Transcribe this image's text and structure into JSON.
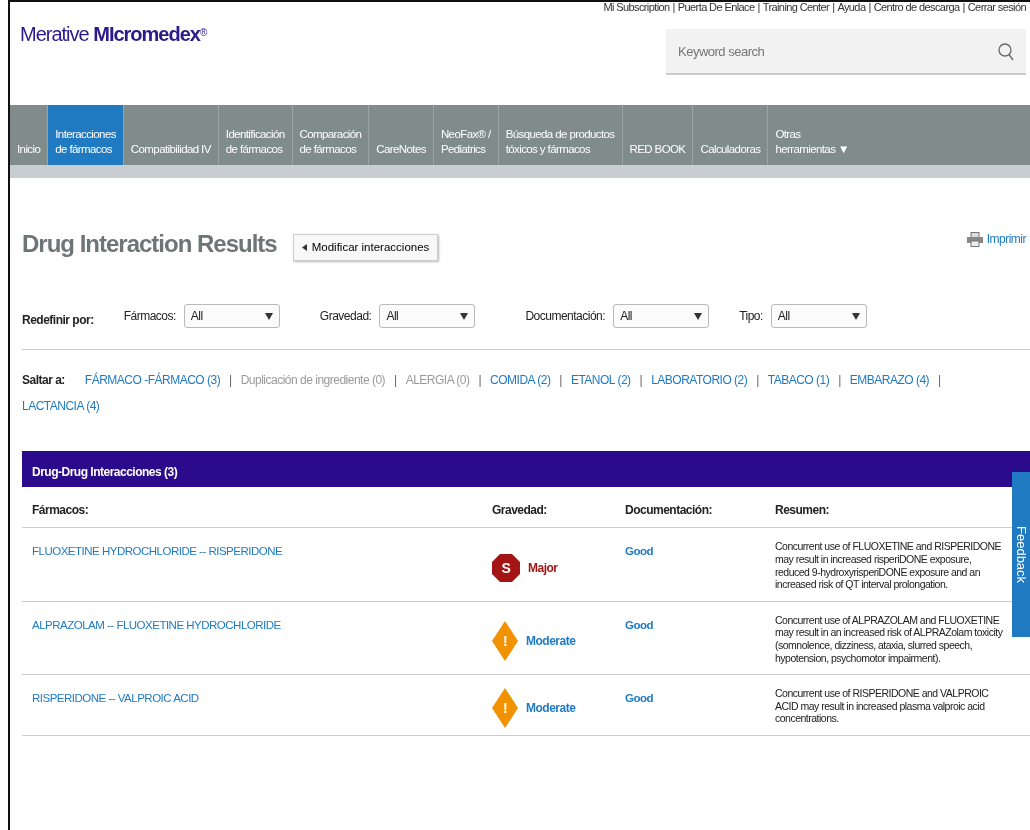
{
  "brand": {
    "prefix": "Merative ",
    "name": "MIcromedex",
    "mark": "®"
  },
  "top_links": [
    "Mi Subscription",
    "Puerta De Enlace",
    "Training Center",
    "Ayuda",
    "Centro de descarga",
    "Cerrar sesión"
  ],
  "top_link_separator": "|",
  "search": {
    "placeholder": "Keyword search"
  },
  "nav": [
    {
      "lines": [
        "Inicio"
      ],
      "selected": false
    },
    {
      "lines": [
        "Interacciones",
        "de fármacos"
      ],
      "selected": true
    },
    {
      "lines": [
        "Compatibilidad IV"
      ],
      "selected": false
    },
    {
      "lines": [
        "Identificación",
        "de fármacos"
      ],
      "selected": false
    },
    {
      "lines": [
        "Comparación",
        "de fármacos"
      ],
      "selected": false
    },
    {
      "lines": [
        "CareNotes"
      ],
      "selected": false
    },
    {
      "lines": [
        "NeoFax® /",
        "Pediatrics"
      ],
      "selected": false
    },
    {
      "lines": [
        "Búsqueda de productos",
        "tóxicos y fármacos"
      ],
      "selected": false
    },
    {
      "lines": [
        "RED BOOK"
      ],
      "selected": false
    },
    {
      "lines": [
        "Calculadoras"
      ],
      "selected": false
    },
    {
      "lines": [
        "Otras",
        "herramientas ▼"
      ],
      "selected": false
    }
  ],
  "title": "Drug Interaction Results",
  "modify_button": "Modificar interacciones",
  "print_link": "Imprimir",
  "filters": {
    "label": "Redefinir por:",
    "items": [
      {
        "label": "Fármacos:",
        "value": "All"
      },
      {
        "label": "Gravedad:",
        "value": "All"
      },
      {
        "label": "Documentación:",
        "value": "All"
      },
      {
        "label": "Tipo:",
        "value": "All"
      }
    ]
  },
  "jump": {
    "label": "Saltar a:",
    "separator": "|",
    "links": [
      {
        "text": "FÁRMACO -FÁRMACO (3)",
        "disabled": false
      },
      {
        "text": "Duplicación de ingrediente (0)",
        "disabled": true
      },
      {
        "text": "ALERGIA (0)",
        "disabled": true
      },
      {
        "text": "COMIDA (2)",
        "disabled": false
      },
      {
        "text": "ETANOL (2)",
        "disabled": false
      },
      {
        "text": "LABORATORIO (2)",
        "disabled": false
      },
      {
        "text": "TABACO (1)",
        "disabled": false
      },
      {
        "text": "EMBARAZO (4)",
        "disabled": false
      },
      {
        "text": "LACTANCIA (4)",
        "disabled": false
      }
    ]
  },
  "section": {
    "title": "Drug-Drug Interacciones (3)",
    "columns": [
      "Fármacos:",
      "Gravedad:",
      "Documentación:",
      "Resumen:"
    ],
    "rows": [
      {
        "drugs": "FLUOXETINE HYDROCHLORIDE -- RISPERIDONE",
        "severity": {
          "kind": "major",
          "icon_text": "S",
          "text": "Major"
        },
        "documentation": "Good",
        "summary": "Concurrent use of FLUOXETINE and RISPERIDONE may result in increased risperiDONE exposure, reduced 9-hydroxyrisperiDONE exposure and an increased risk of QT interval prolongation."
      },
      {
        "drugs": "ALPRAZOLAM -- FLUOXETINE HYDROCHLORIDE",
        "severity": {
          "kind": "moderate",
          "icon_text": "!",
          "text": "Moderate"
        },
        "documentation": "Good",
        "summary": "Concurrent use of ALPRAZOLAM and FLUOXETINE may result in an increased risk of ALPRAZolam toxicity (somnolence, dizziness, ataxia, slurred speech, hypotension, psychomotor impairment)."
      },
      {
        "drugs": "RISPERIDONE -- VALPROIC ACID",
        "severity": {
          "kind": "moderate",
          "icon_text": "!",
          "text": "Moderate"
        },
        "documentation": "Good",
        "summary": "Concurrent use of RISPERIDONE and VALPROIC ACID may result in increased plasma valproic acid concentrations."
      }
    ]
  },
  "feedback_tab": "Feedback"
}
